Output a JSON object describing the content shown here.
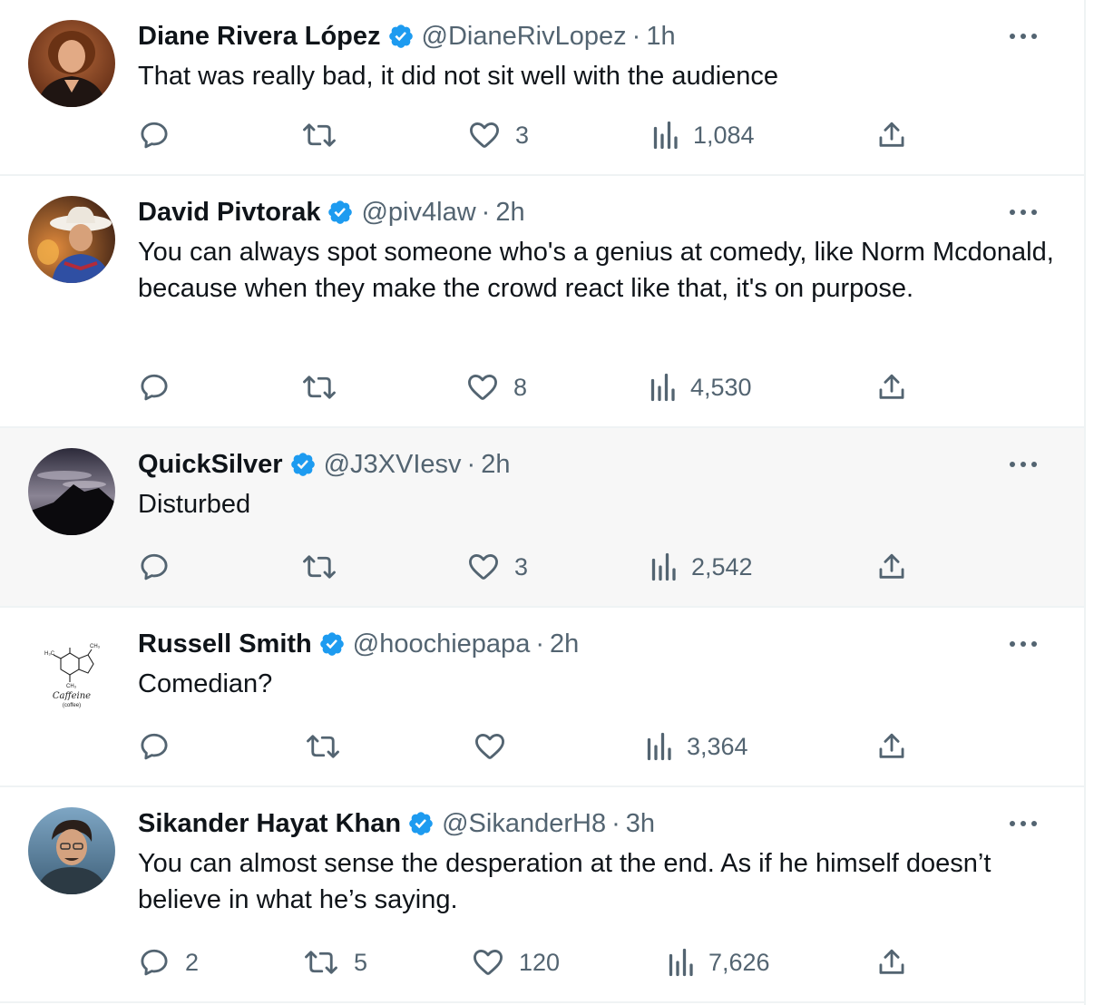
{
  "tweets": [
    {
      "name": "Diane Rivera López",
      "handle": "@DianeRivLopez",
      "time": "1h",
      "text": "That was really bad, it did not sit well with the audience",
      "replies": "",
      "retweets": "",
      "likes": "3",
      "views": "1,084"
    },
    {
      "name": "David Pivtorak",
      "handle": "@piv4law",
      "time": "2h",
      "text": "You can always spot someone who's a genius at comedy, like Norm Mcdonald, because when they make the crowd react like that, it's on purpose.",
      "replies": "",
      "retweets": "",
      "likes": "8",
      "views": "4,530"
    },
    {
      "name": "QuickSilver",
      "handle": "@J3XVIesv",
      "time": "2h",
      "text": "Disturbed",
      "replies": "",
      "retweets": "",
      "likes": "3",
      "views": "2,542"
    },
    {
      "name": "Russell Smith",
      "handle": "@hoochiepapa",
      "time": "2h",
      "text": "Comedian?",
      "replies": "",
      "retweets": "",
      "likes": "",
      "views": "3,364",
      "avatar_caption": "Caffeine",
      "avatar_subcaption": "(coffee)"
    },
    {
      "name": "Sikander Hayat Khan",
      "handle": "@SikanderH8",
      "time": "3h",
      "text": "You can almost sense the desperation at the end. As if he himself doesn’t believe in what he’s saying.",
      "replies": "2",
      "retweets": "5",
      "likes": "120",
      "views": "7,626"
    }
  ],
  "separator": "·",
  "icons": {
    "verified": "verified-badge-icon",
    "more": "more-dots-icon",
    "reply": "reply-icon",
    "retweet": "retweet-icon",
    "like": "like-icon",
    "views": "views-icon",
    "share": "share-icon"
  },
  "colors": {
    "verified": "#1d9bf0",
    "text": "#0f1419",
    "secondary": "#536471",
    "divider": "#eff3f4",
    "highlight_bg": "#f7f7f7"
  }
}
